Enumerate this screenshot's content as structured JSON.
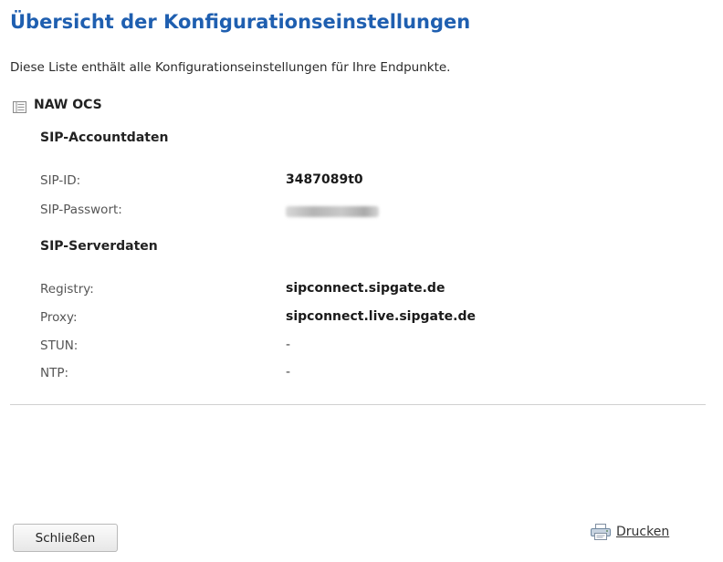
{
  "header": {
    "title": "Übersicht der Konfigurationseinstellungen",
    "description": "Diese Liste enthält alle Konfigurationseinstellungen für Ihre Endpunkte."
  },
  "endpoint": {
    "icon": "list-icon",
    "name": "NAW OCS"
  },
  "account": {
    "title": "SIP-Accountdaten",
    "id_label": "SIP-ID:",
    "id_value": "3487089t0",
    "password_label": "SIP-Passwort:",
    "password_value_state": "blurred"
  },
  "server": {
    "title": "SIP-Serverdaten",
    "registry_label": "Registry:",
    "registry_value": "sipconnect.sipgate.de",
    "proxy_label": "Proxy:",
    "proxy_value": "sipconnect.live.sipgate.de",
    "stun_label": "STUN:",
    "stun_value": "-",
    "ntp_label": "NTP:",
    "ntp_value": "-"
  },
  "footer": {
    "close_label": "Schließen",
    "print_label": "Drucken",
    "print_icon": "printer-icon"
  },
  "colors": {
    "title": "#1f5fb0",
    "divider": "#d0d0d0"
  }
}
